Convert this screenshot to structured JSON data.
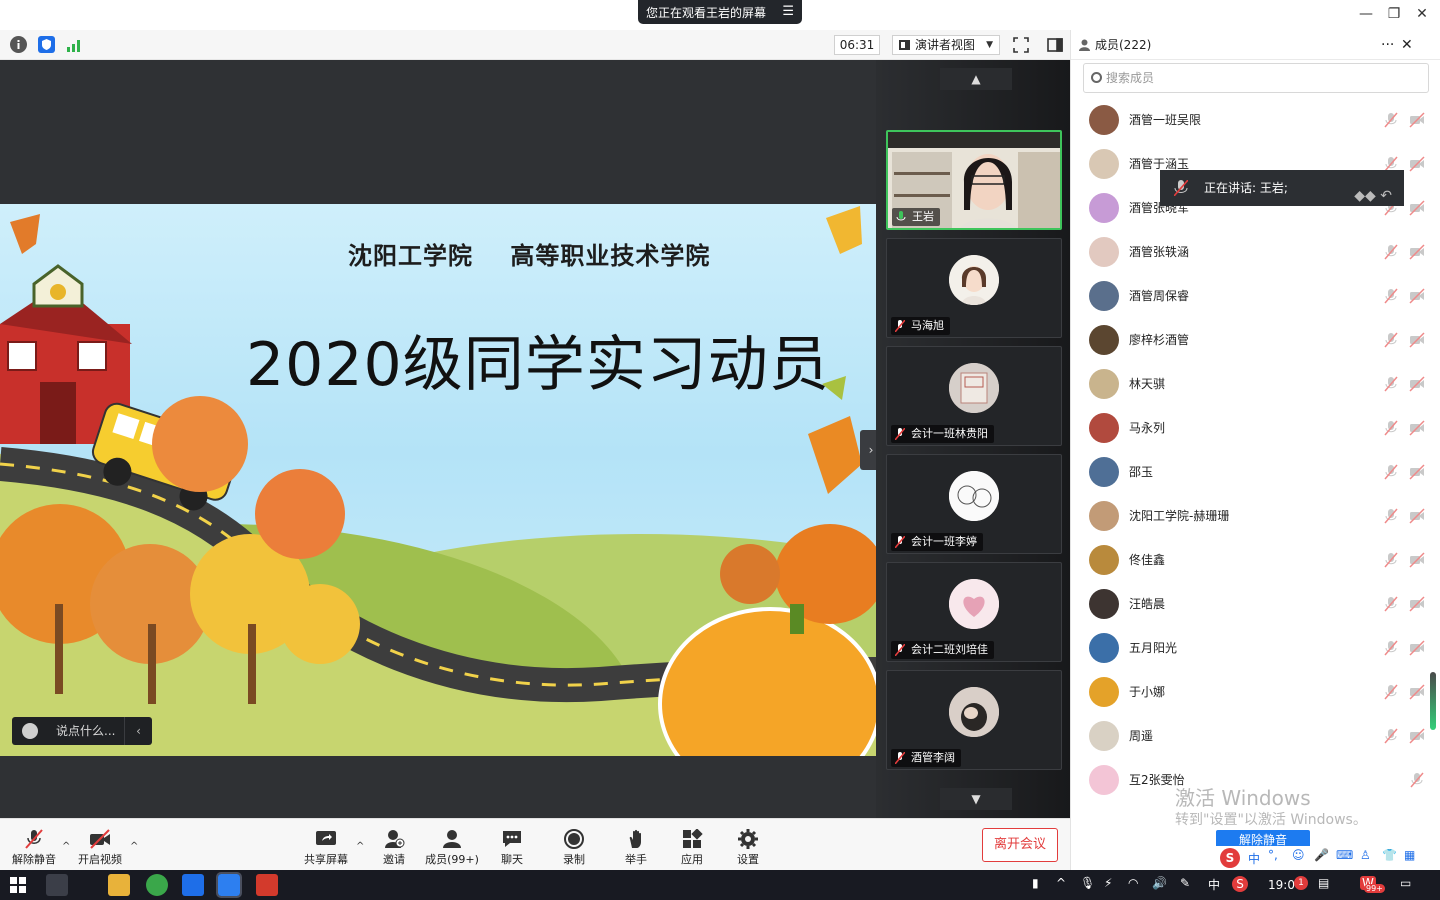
{
  "window": {
    "screen_banner": "您正在观看王岩的屏幕",
    "minimize": "—",
    "restore": "❐",
    "close": "✕"
  },
  "topbar": {
    "timer": "06:31",
    "view_mode": "演讲者视图"
  },
  "slide": {
    "org": "沈阳工学院    高等职业技术学院",
    "title": "2020级同学实习动员"
  },
  "chat": {
    "placeholder": "说点什么..."
  },
  "gallery": [
    {
      "name": "王岩",
      "active": true
    },
    {
      "name": "马海旭"
    },
    {
      "name": "会计一班林贵阳"
    },
    {
      "name": "会计一班李婷"
    },
    {
      "name": "会计二班刘培佳"
    },
    {
      "name": "酒管李阔"
    }
  ],
  "panel": {
    "title": "成员(222)",
    "more": "···",
    "close": "✕",
    "search_placeholder": "搜索成员",
    "speaking": "正在讲话: 王岩;",
    "members": [
      {
        "name": "酒管一班吴限",
        "color": "#8a5a44"
      },
      {
        "name": "酒管于涵玉",
        "color": "#d9c8b4"
      },
      {
        "name": "酒管张晓军",
        "color": "#c79bd6"
      },
      {
        "name": "酒管张轶涵",
        "color": "#e2c9c0"
      },
      {
        "name": "酒管周保睿",
        "color": "#5a6f8c"
      },
      {
        "name": "廖梓杉酒管",
        "color": "#5b4630"
      },
      {
        "name": "林天骐",
        "color": "#c9b48d"
      },
      {
        "name": "马永列",
        "color": "#b14a3e"
      },
      {
        "name": "邵玉",
        "color": "#4f6f96"
      },
      {
        "name": "沈阳工学院-赫珊珊",
        "color": "#c29b77"
      },
      {
        "name": "佟佳鑫",
        "color": "#b98a3c"
      },
      {
        "name": "汪皓晨",
        "color": "#3d3431"
      },
      {
        "name": "五月阳光",
        "color": "#3b6fa8"
      },
      {
        "name": "于小娜",
        "color": "#e4a229"
      },
      {
        "name": "周遥",
        "color": "#d9d1c4"
      },
      {
        "name": "互2张雯怡",
        "color": "#f3c5d6"
      }
    ],
    "watermark_line1": "激活 Windows",
    "watermark_line2": "转到\"设置\"以激活 Windows。",
    "unmute_all": "解除静音"
  },
  "bottombar": {
    "unmute": "解除静音",
    "start_video": "开启视频",
    "share": "共享屏幕",
    "invite": "邀请",
    "members": "成员(99+)",
    "chat": "聊天",
    "record": "录制",
    "raise_hand": "举手",
    "apps": "应用",
    "settings": "设置",
    "leave": "离开会议"
  },
  "ime": {
    "lang": "中"
  },
  "taskbar": {
    "ime_lang": "中",
    "clock": "19:0",
    "badge": "1",
    "notify_badge": "99+"
  },
  "colors": {
    "stage_bg": "#2f3134",
    "active_border": "#3ec45b",
    "leave_red": "#e23c3c",
    "accent_blue": "#1d7bf0"
  }
}
